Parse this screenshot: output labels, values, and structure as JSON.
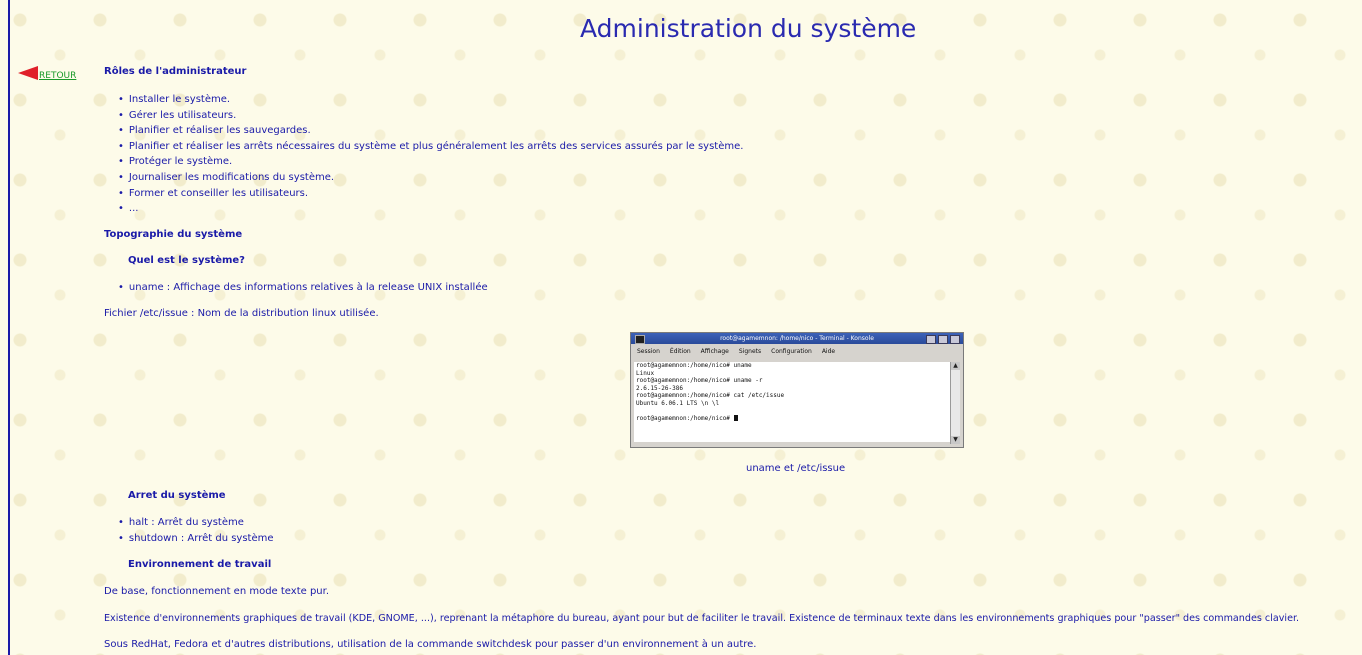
{
  "title": "Administration du système",
  "back_label": "RETOUR",
  "sections": {
    "roles_heading": "Rôles de l'administrateur",
    "roles": [
      "Installer le système.",
      "Gérer les utilisateurs.",
      "Planifier et réaliser les sauvegardes.",
      "Planifier et réaliser les arrêts nécessaires du système et plus généralement les arrêts des services assurés par le système.",
      "Protéger le système.",
      "Journaliser les modifications du système.",
      "Former et conseiller les utilisateurs.",
      "..."
    ],
    "topo_heading": "Topographie du système",
    "which_heading": "Quel est le système?",
    "uname_item": "uname : Affichage des informations relatives à la release UNIX installée",
    "issue_text": "Fichier /etc/issue : Nom de la distribution linux utilisée.",
    "image_caption": "uname et /etc/issue",
    "stop_heading": "Arret du système",
    "stop_items": [
      "halt : Arrêt du système",
      "shutdown : Arrêt du système"
    ],
    "env_heading": "Environnement de travail",
    "env_p1": "De base, fonctionnement en mode texte pur.",
    "env_p2": "Existence d'environnements graphiques de travail (KDE, GNOME, ...), reprenant la métaphore du bureau, ayant pour but de faciliter le travail. Existence de terminaux texte dans les environnements graphiques pour \"passer\" des commandes clavier.",
    "env_p3": "Sous RedHat, Fedora et d'autres distributions, utilisation de la commande switchdesk pour passer d'un environnement à un autre."
  },
  "terminal": {
    "title": "root@agamemnon: /home/nico - Terminal - Konsole",
    "menu": [
      "Session",
      "Édition",
      "Affichage",
      "Signets",
      "Configuration",
      "Aide"
    ],
    "lines": [
      "root@agamemnon:/home/nico# uname",
      "Linux",
      "root@agamemnon:/home/nico# uname -r",
      "2.6.15-26-386",
      "root@agamemnon:/home/nico# cat /etc/issue",
      "Ubuntu 6.06.1 LTS \\n \\l",
      "",
      "root@agamemnon:/home/nico# "
    ]
  },
  "colors": {
    "text": "#1a1aa8",
    "background": "#fdfbe9",
    "back_arrow": "#e0202a",
    "back_link": "#1a9a2a"
  }
}
